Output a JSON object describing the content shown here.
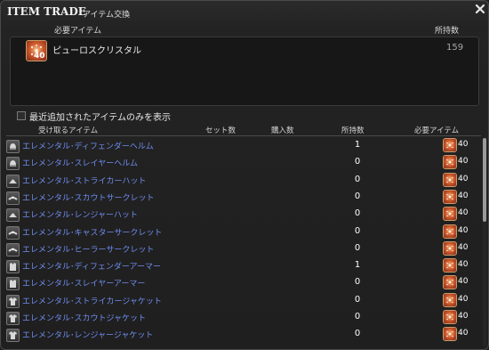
{
  "window": {
    "title": "ITEM TRADE",
    "subtitle": "アイテム交換"
  },
  "top_panel": {
    "required_label": "必要アイテム",
    "owned_label": "所持数",
    "item": {
      "icon": "pure-crystal-icon",
      "icon_qty": "40",
      "name": "ピューロスクリスタル",
      "owned": "159"
    }
  },
  "filter": {
    "label": "最近追加されたアイテムのみを表示",
    "checked": false
  },
  "table": {
    "headers": {
      "receive": "受け取るアイテム",
      "set_count": "セット数",
      "purchase_count": "購入数",
      "owned": "所持数",
      "required": "必要アイテム"
    },
    "rows": [
      {
        "icon": "helmet-icon",
        "name": "エレメンタル･ディフェンダーヘルム",
        "owned": "1",
        "req_qty": "40"
      },
      {
        "icon": "helmet-icon",
        "name": "エレメンタル･スレイヤーヘルム",
        "owned": "0",
        "req_qty": "40"
      },
      {
        "icon": "hat-icon",
        "name": "エレメンタル･ストライカーハット",
        "owned": "0",
        "req_qty": "40"
      },
      {
        "icon": "circlet-icon",
        "name": "エレメンタル･スカウトサークレット",
        "owned": "0",
        "req_qty": "40"
      },
      {
        "icon": "hat-icon",
        "name": "エレメンタル･レンジャーハット",
        "owned": "0",
        "req_qty": "40"
      },
      {
        "icon": "circlet-icon",
        "name": "エレメンタル･キャスターサークレット",
        "owned": "0",
        "req_qty": "40"
      },
      {
        "icon": "circlet-icon",
        "name": "エレメンタル･ヒーラーサークレット",
        "owned": "0",
        "req_qty": "40"
      },
      {
        "icon": "armor-icon",
        "name": "エレメンタル･ディフェンダーアーマー",
        "owned": "1",
        "req_qty": "40"
      },
      {
        "icon": "armor-icon",
        "name": "エレメンタル･スレイヤーアーマー",
        "owned": "0",
        "req_qty": "40"
      },
      {
        "icon": "jacket-icon",
        "name": "エレメンタル･ストライカージャケット",
        "owned": "0",
        "req_qty": "40"
      },
      {
        "icon": "jacket-icon",
        "name": "エレメンタル･スカウトジャケット",
        "owned": "0",
        "req_qty": "40"
      },
      {
        "icon": "jacket-icon",
        "name": "エレメンタル･レンジャージャケット",
        "owned": "0",
        "req_qty": "40"
      }
    ]
  },
  "colors": {
    "item_link": "#6f8df0",
    "accent_crystal": "#d05a2e"
  },
  "scroll": {
    "position": 0.0
  }
}
